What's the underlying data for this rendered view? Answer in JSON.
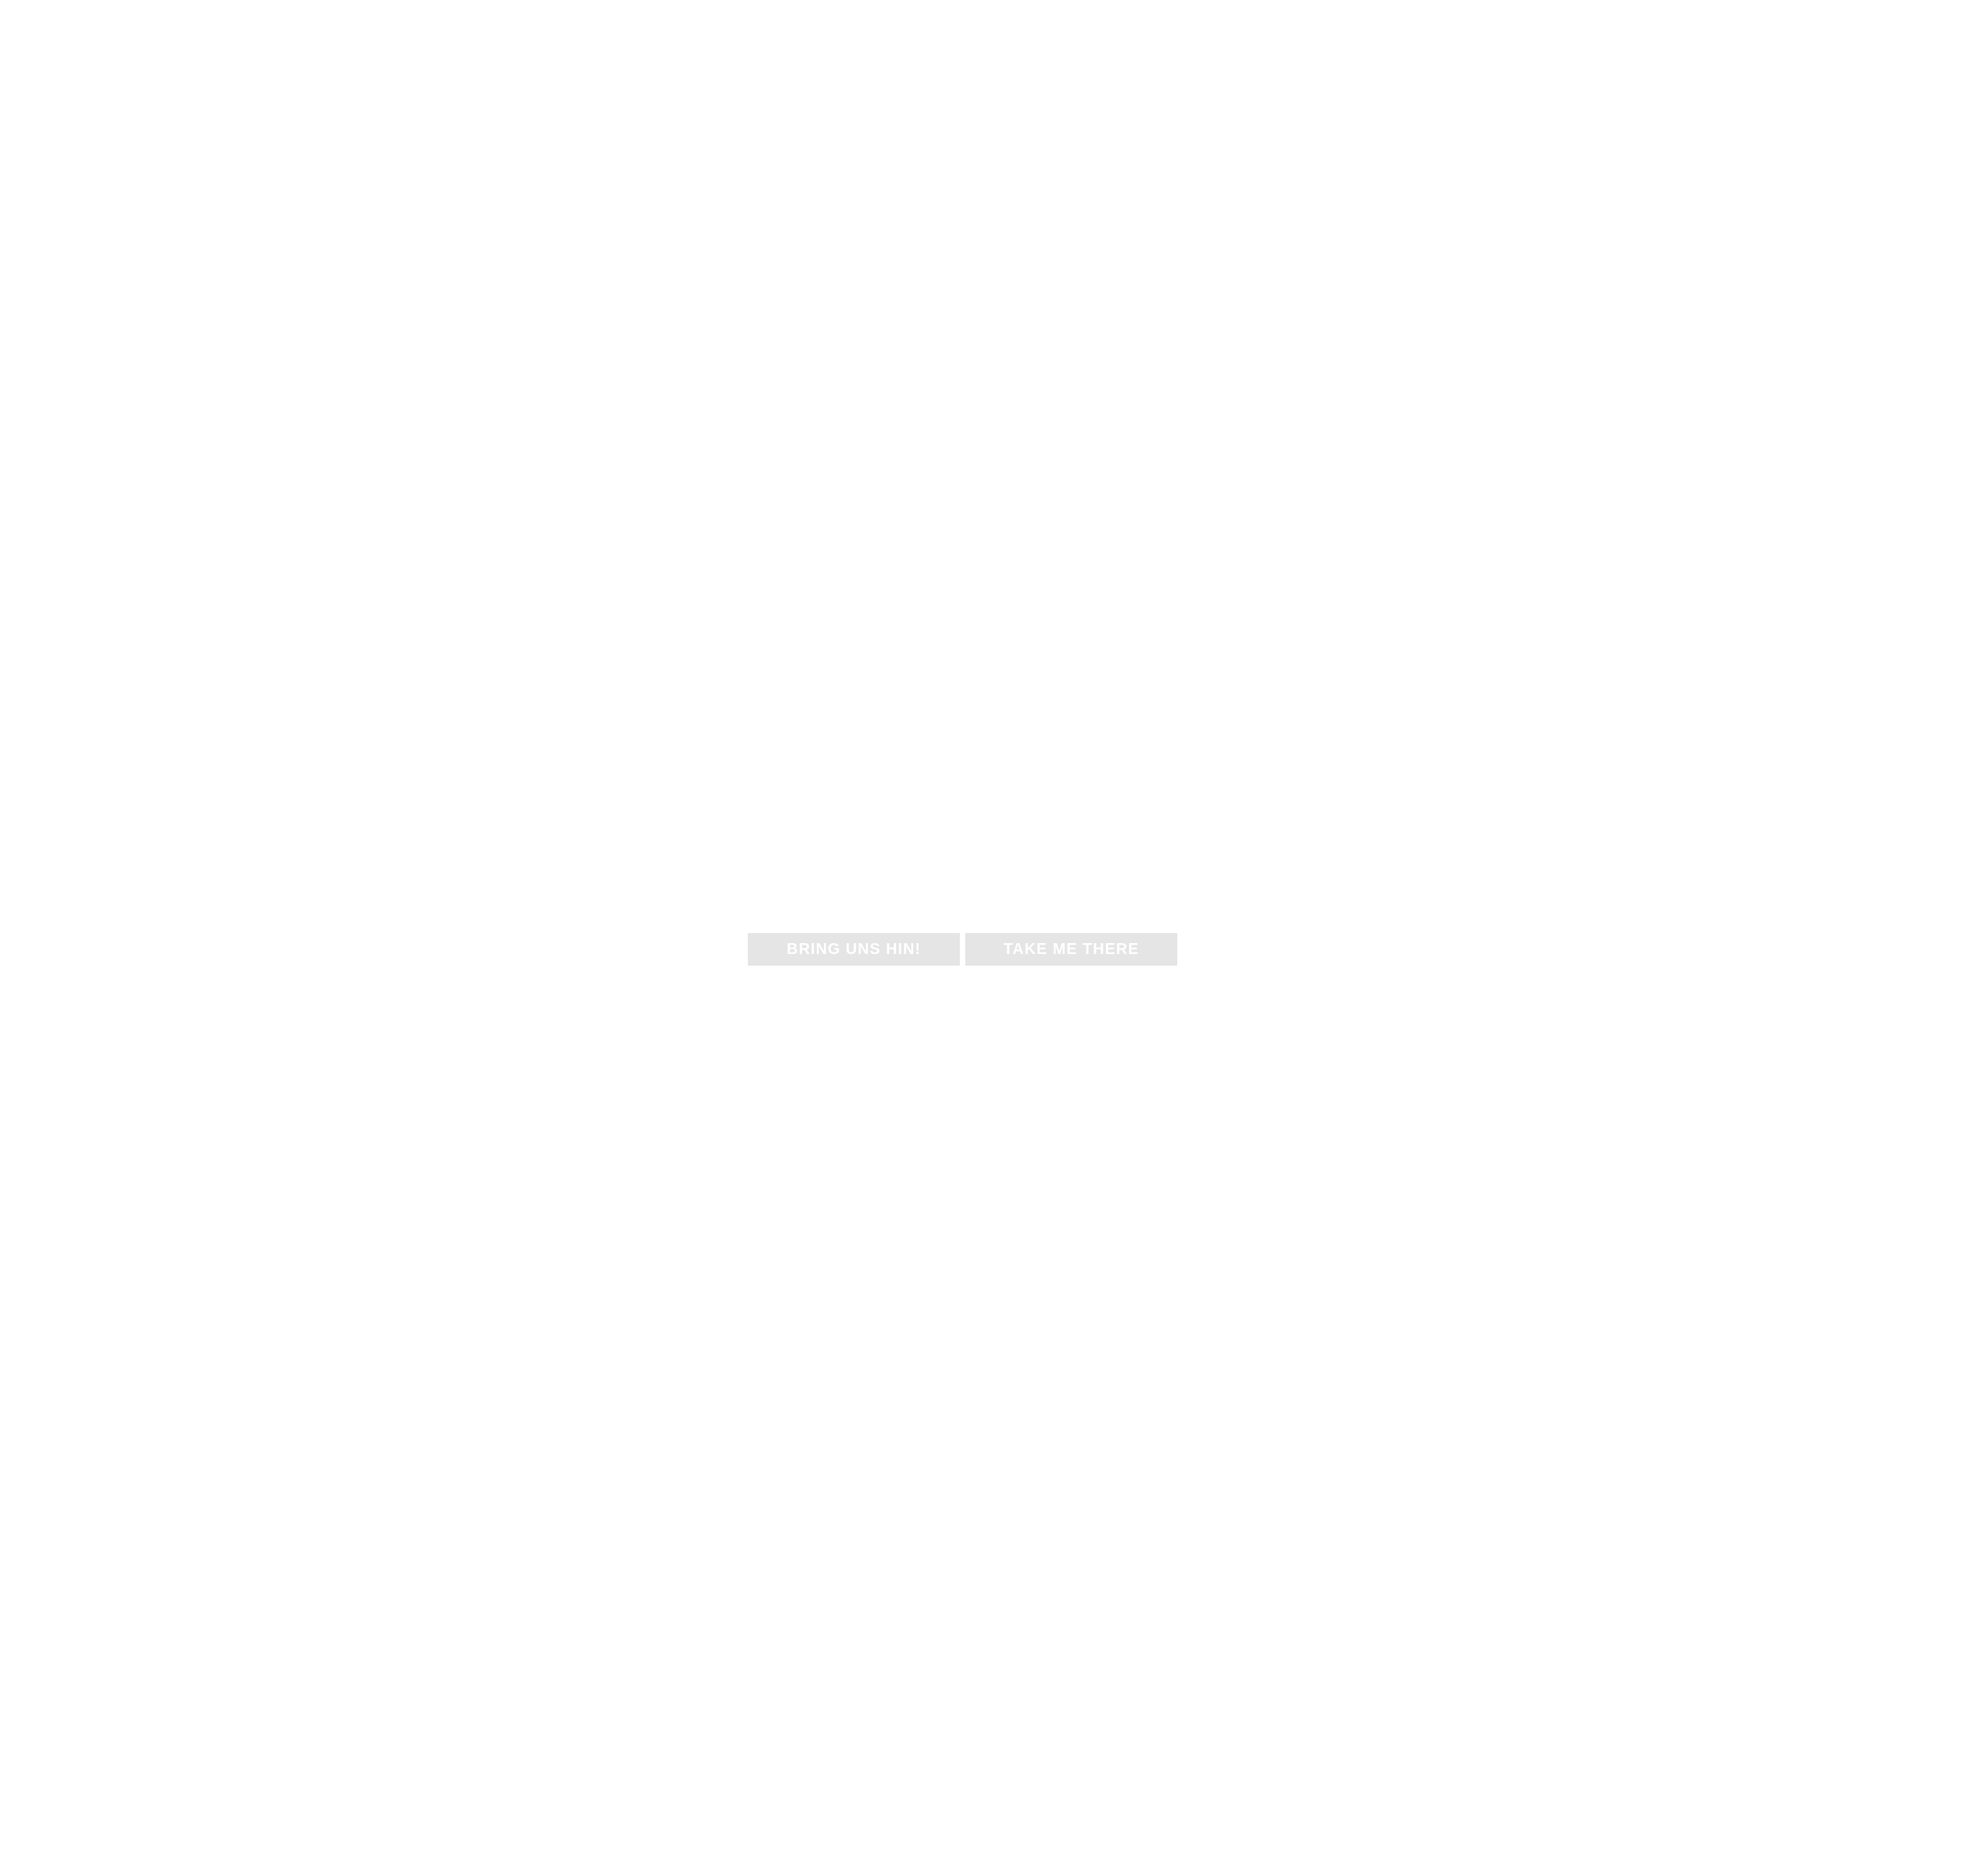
{
  "splash": {
    "buttons": [
      {
        "label": "BRING UNS HIN!"
      },
      {
        "label": "TAKE ME THERE"
      }
    ]
  },
  "colors": {
    "background": "#ffffff",
    "button_fill": "#e5e5e5",
    "button_text": "#ffffff"
  }
}
